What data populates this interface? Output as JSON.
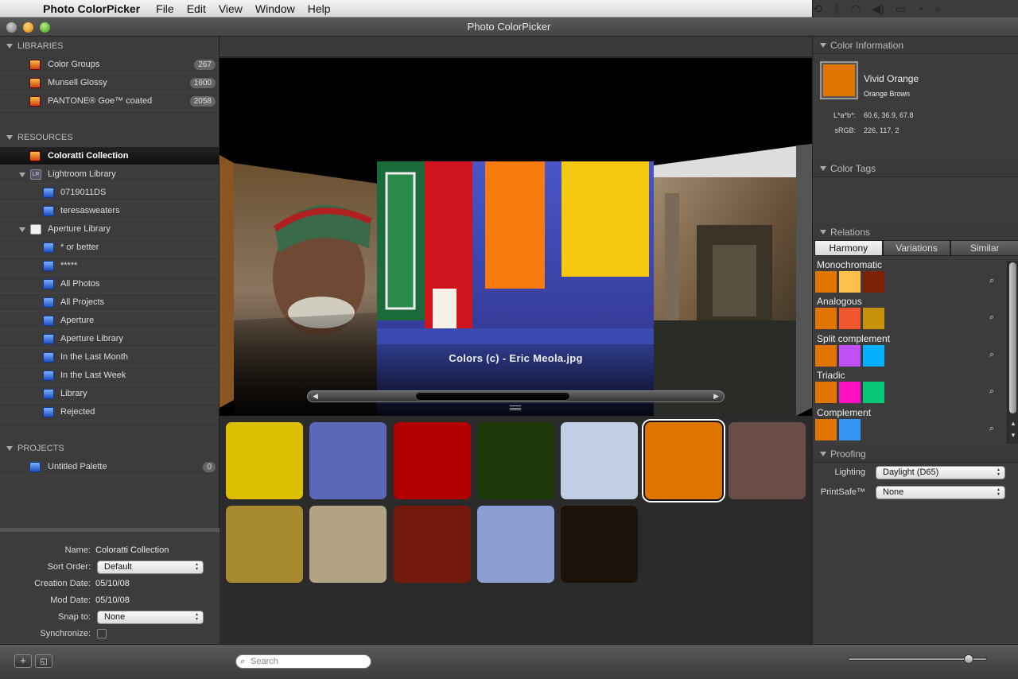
{
  "menubar": {
    "app_name": "Photo ColorPicker",
    "items": [
      "File",
      "Edit",
      "View",
      "Window",
      "Help"
    ]
  },
  "window": {
    "title": "Photo ColorPicker"
  },
  "sidebar": {
    "libraries_label": "LIBRARIES",
    "libraries": [
      {
        "label": "Color Groups",
        "count": "267"
      },
      {
        "label": "Munsell Glossy",
        "count": "1600"
      },
      {
        "label": "PANTONE® Goe™ coated",
        "count": "2058"
      }
    ],
    "resources_label": "RESOURCES",
    "resources": [
      {
        "label": "Coloratti Collection"
      },
      {
        "label": "Lightroom Library"
      },
      {
        "label": "0719011DS"
      },
      {
        "label": "teresasweaters"
      },
      {
        "label": "Aperture Library"
      },
      {
        "label": "* or better"
      },
      {
        "label": "*****"
      },
      {
        "label": "All Photos"
      },
      {
        "label": "All Projects"
      },
      {
        "label": "Aperture"
      },
      {
        "label": "Aperture Library"
      },
      {
        "label": "In the Last Month"
      },
      {
        "label": "In the Last Week"
      },
      {
        "label": "Library"
      },
      {
        "label": "Rejected"
      }
    ],
    "lr_badge": "LR",
    "projects_label": "PROJECTS",
    "projects": [
      {
        "label": "Untitled Palette",
        "count": "0"
      }
    ]
  },
  "props": {
    "name_label": "Name:",
    "name_value": "Coloratti Collection",
    "sort_label": "Sort Order:",
    "sort_value": "Default",
    "created_label": "Creation Date:",
    "created_value": "05/10/08",
    "mod_label": "Mod Date:",
    "mod_value": "05/10/08",
    "snap_label": "Snap to:",
    "snap_value": "None",
    "sync_label": "Synchronize:"
  },
  "viewer": {
    "caption": "Colors (c) - Eric Meola.jpg",
    "scroll_position": 0.31
  },
  "swatches": [
    "#dcbf00",
    "#5b67b8",
    "#b00000",
    "#1e3a0a",
    "#c0cfe3",
    "#de7502",
    "#6a4d48",
    "#a88a2e",
    "#b2a384",
    "#731a0c",
    "#8d9fd2",
    "#1b130a"
  ],
  "selected_swatch": 5,
  "color_info": {
    "header": "Color Information",
    "swatch": "#e27502",
    "name": "Vivid Orange",
    "subname": "Orange Brown",
    "lab_label": "L*a*b*:",
    "lab_value": "60.6, 36.9, 67.8",
    "srgb_label": "sRGB:",
    "srgb_value": "226, 117, 2"
  },
  "color_tags": {
    "header": "Color Tags"
  },
  "relations": {
    "header": "Relations",
    "tabs": [
      "Harmony",
      "Variations",
      "Similar"
    ],
    "groups": [
      {
        "label": "Monochromatic",
        "colors": [
          "#e27502",
          "#ffbf4a",
          "#7c2306"
        ]
      },
      {
        "label": "Analogous",
        "colors": [
          "#e27502",
          "#f2562e",
          "#c6920a"
        ]
      },
      {
        "label": "Split complement",
        "colors": [
          "#e27502",
          "#c050f5",
          "#05b0ff"
        ]
      },
      {
        "label": "Triadic",
        "colors": [
          "#e27502",
          "#ff10c0",
          "#08c878"
        ]
      },
      {
        "label": "Complement",
        "colors": [
          "#e27502",
          "#3494f5"
        ]
      }
    ]
  },
  "proofing": {
    "header": "Proofing",
    "lighting_label": "Lighting",
    "lighting_value": "Daylight (D65)",
    "printsafe_label": "PrintSafe™",
    "printsafe_value": "None"
  },
  "bottom": {
    "search_placeholder": "Search",
    "zoom": 0.85
  }
}
